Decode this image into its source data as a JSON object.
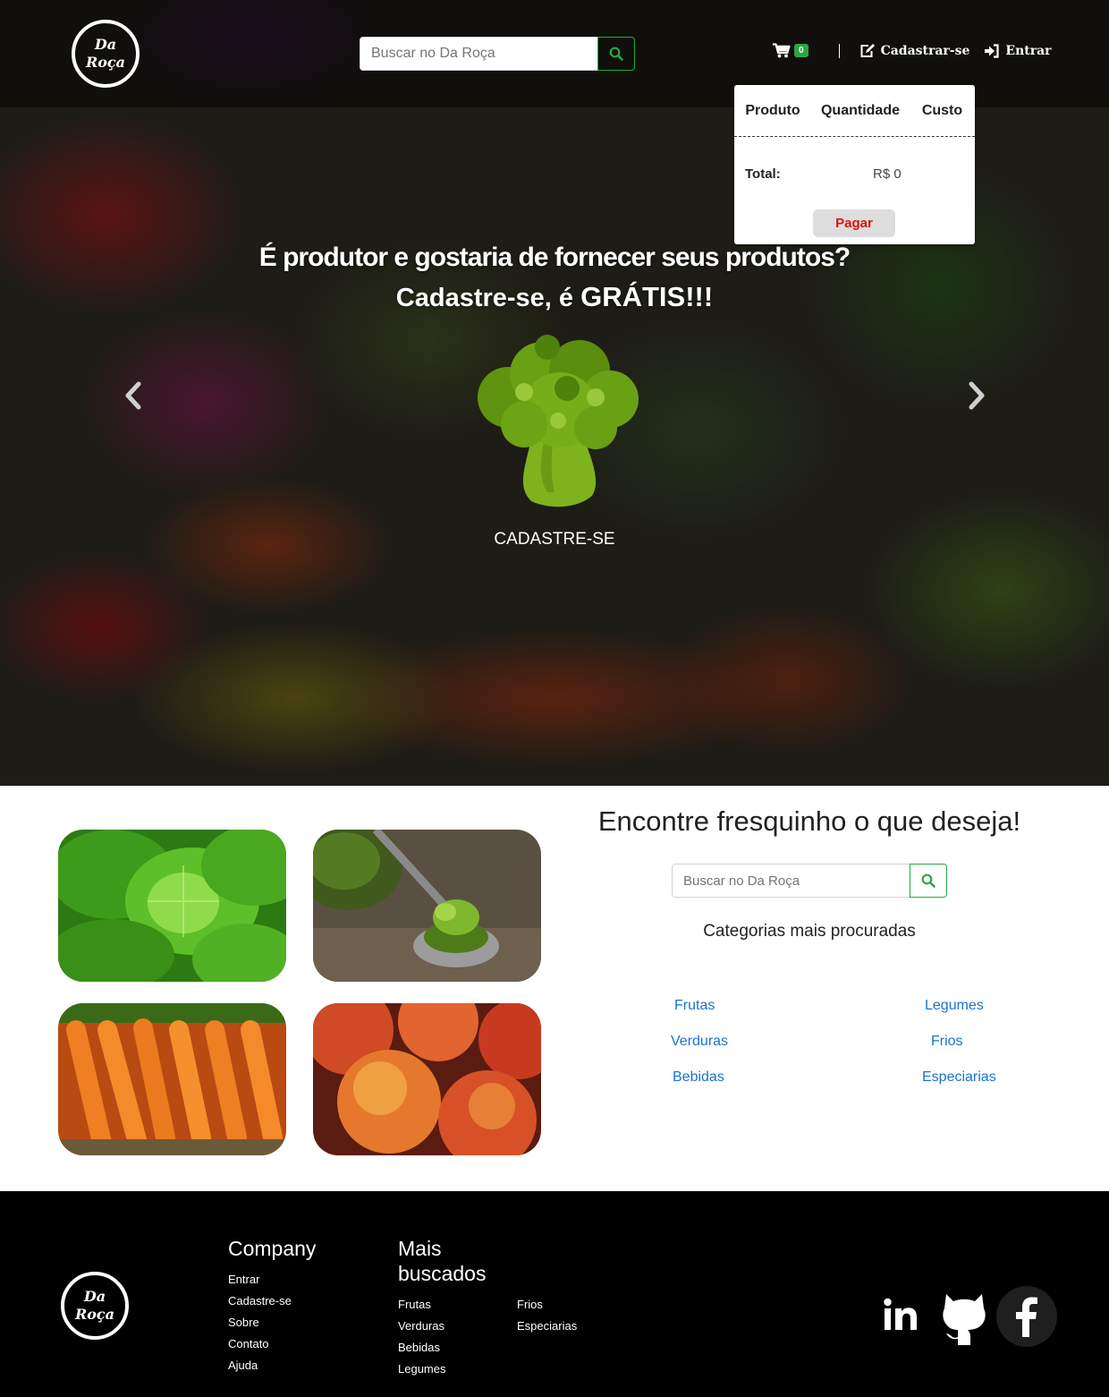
{
  "brand": {
    "logo_line1": "Da",
    "logo_line2": "Roça"
  },
  "search": {
    "placeholder": "Buscar no Da Roça"
  },
  "nav": {
    "cart_count": "0",
    "signup": "Cadastrar-se",
    "login": "Entrar"
  },
  "cart": {
    "col_product": "Produto",
    "col_quantity": "Quantidade",
    "col_cost": "Custo",
    "total_label": "Total:",
    "total_value": "R$ 0",
    "pay_label": "Pagar"
  },
  "hero": {
    "line1": "É produtor e gostaria de fornecer seus produtos?",
    "line2_prefix": "Cadastre-se, é ",
    "line2_bold": "GRÁTIS!!!",
    "cta": "CADASTRE-SE"
  },
  "find": {
    "title": "Encontre fresquinho o que deseja!",
    "categories_title": "Categorias mais procuradas",
    "categories": [
      "Frutas",
      "Legumes",
      "Verduras",
      "Frios",
      "Bebidas",
      "Especiarias"
    ]
  },
  "footer": {
    "company_title": "Company",
    "company_links": [
      "Entrar",
      "Cadastre-se",
      "Sobre",
      "Contato",
      "Ajuda"
    ],
    "popular_title_1": "Mais",
    "popular_title_2": "buscados",
    "popular_col1": [
      "Frutas",
      "Verduras",
      "Bebidas",
      "Legumes"
    ],
    "popular_col2": [
      "Frios",
      "Especiarias"
    ]
  },
  "colors": {
    "accent_green": "#28a745",
    "link_blue": "#1a73d1",
    "pay_red": "#e01010",
    "footer_bg": "#000000"
  }
}
